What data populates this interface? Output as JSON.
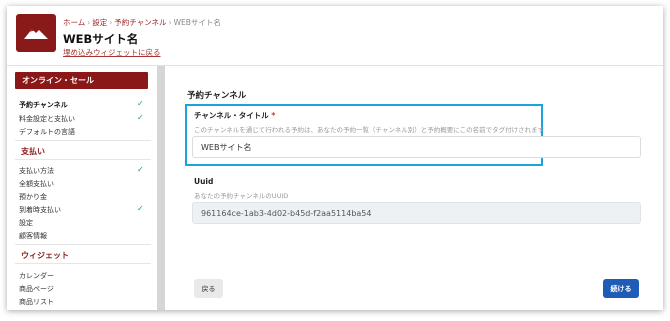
{
  "header": {
    "breadcrumb": [
      "ホーム",
      "設定",
      "予約チャンネル",
      "WEBサイト名"
    ],
    "breadcrumb_sep": "›",
    "title": "WEBサイト名",
    "back_link": "埋め込みウィジェットに戻る"
  },
  "sidebar": {
    "sections": [
      {
        "title": "オンライン・セール",
        "style": "filled"
      },
      {
        "title": "支払い",
        "style": "plain"
      },
      {
        "title": "ウィジェット",
        "style": "plain"
      }
    ],
    "items": [
      {
        "label": "予約チャンネル",
        "checked": true,
        "active": true
      },
      {
        "label": "料金設定と支払い",
        "checked": true,
        "active": false
      },
      {
        "label": "デフォルトの言語",
        "checked": false,
        "active": false
      },
      {
        "label": "支払い方法",
        "checked": true,
        "active": false
      },
      {
        "label": "全額支払い",
        "checked": false,
        "active": false
      },
      {
        "label": "預かり金",
        "checked": false,
        "active": false
      },
      {
        "label": "到着時支払い",
        "checked": true,
        "active": false
      },
      {
        "label": "設定",
        "checked": false,
        "active": false
      },
      {
        "label": "顧客情報",
        "checked": false,
        "active": false
      },
      {
        "label": "カレンダー",
        "checked": false,
        "active": false
      },
      {
        "label": "商品ページ",
        "checked": false,
        "active": false
      },
      {
        "label": "商品リスト",
        "checked": false,
        "active": false
      }
    ],
    "check_glyph": "✓"
  },
  "main": {
    "section_title": "予約チャンネル",
    "channel_title": {
      "label": "チャンネル・タイトル",
      "required_mark": "*",
      "description": "このチャンネルを通じて行われる予約は、あなたの予約一覧（チャンネル別）と予約概要にこの名前でタグ付けされます",
      "value": "WEBサイト名"
    },
    "uuid": {
      "label": "Uuid",
      "description": "あなたの予約チャンネルのUUID",
      "value": "961164ce-1ab3-4d02-b45d-f2aa5114ba54"
    },
    "back_button": "戻る",
    "next_button": "続ける"
  },
  "colors": {
    "brand": "#8a1818",
    "highlight": "#1aa3dd",
    "primary_button": "#1f5cb8",
    "check": "#2ea043"
  },
  "icons": {
    "logo": "mountain-logo-icon"
  }
}
